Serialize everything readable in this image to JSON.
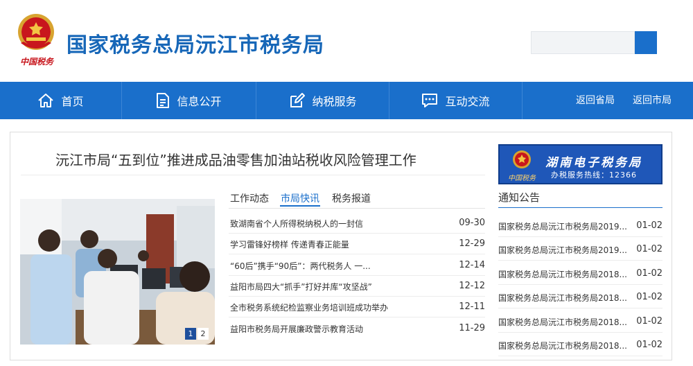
{
  "header": {
    "site_title": "国家税务总局沅江市税务局",
    "emblem_caption": "中国税务",
    "search": {
      "value": "",
      "placeholder": ""
    }
  },
  "nav": {
    "items": [
      {
        "label": "首页",
        "icon": "home-icon"
      },
      {
        "label": "信息公开",
        "icon": "document-icon"
      },
      {
        "label": "纳税服务",
        "icon": "edit-icon"
      },
      {
        "label": "互动交流",
        "icon": "chat-icon"
      }
    ],
    "links": [
      {
        "label": "返回省局"
      },
      {
        "label": "返回市局"
      }
    ]
  },
  "headline": "沅江市局“五到位”推进成品油零售加油站税收风险管理工作",
  "slider": {
    "pages": [
      "1",
      "2"
    ],
    "active": 0
  },
  "tabs": [
    {
      "label": "工作动态",
      "active": false
    },
    {
      "label": "市局快讯",
      "active": true
    },
    {
      "label": "税务报道",
      "active": false
    }
  ],
  "news": [
    {
      "title": "致湖南省个人所得税纳税人的一封信",
      "date": "09-30"
    },
    {
      "title": "学习雷锋好榜样 传递青春正能量",
      "date": "12-29"
    },
    {
      "title": "“60后”携手“90后”：两代税务人 一...",
      "date": "12-14"
    },
    {
      "title": "益阳市局四大“抓手”打好并库“攻坚战”",
      "date": "12-12"
    },
    {
      "title": "全市税务系统纪检监察业务培训班成功举办",
      "date": "12-11"
    },
    {
      "title": "益阳市税务局开展廉政警示教育活动",
      "date": "11-29"
    }
  ],
  "banner": {
    "title": "湖南电子税务局",
    "subtitle": "办税服务热线：12366",
    "logo_text": "中国税务"
  },
  "notices": {
    "title": "通知公告",
    "items": [
      {
        "title": "国家税务总局沅江市税务局2019...",
        "date": "01-02"
      },
      {
        "title": "国家税务总局沅江市税务局2019...",
        "date": "01-02"
      },
      {
        "title": "国家税务总局沅江市税务局2018...",
        "date": "01-02"
      },
      {
        "title": "国家税务总局沅江市税务局2018...",
        "date": "01-02"
      },
      {
        "title": "国家税务总局沅江市税务局2018...",
        "date": "01-02"
      },
      {
        "title": "国家税务总局沅江市税务局2018...",
        "date": "01-02"
      }
    ]
  },
  "colors": {
    "brand_blue": "#1a6fcb",
    "title_blue": "#1767b8",
    "banner_blue": "#1f57b8",
    "emblem_red": "#c8161d"
  }
}
